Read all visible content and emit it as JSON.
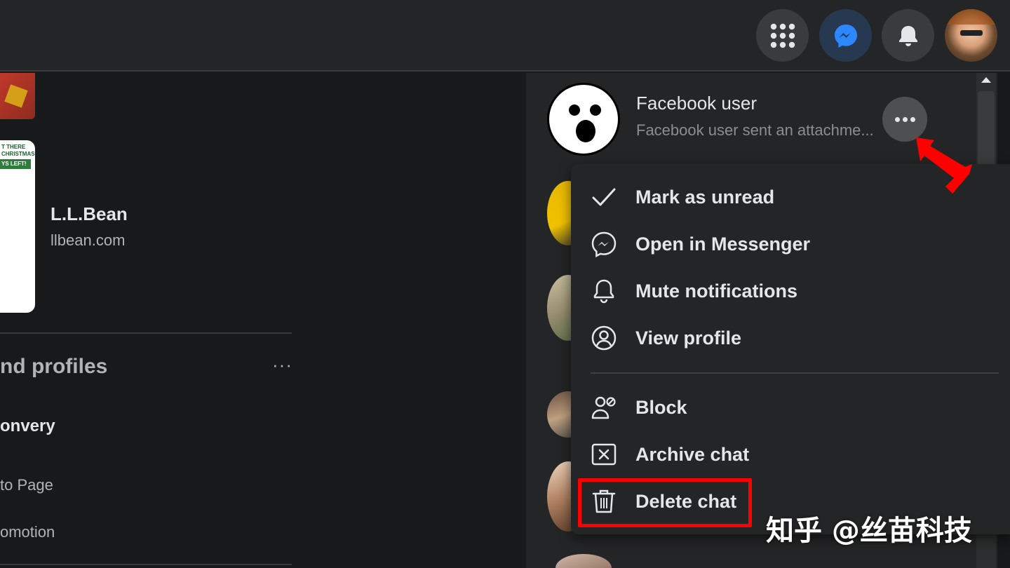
{
  "topbar": {
    "icons": [
      "grid-menu-icon",
      "messenger-icon",
      "notifications-bell-icon",
      "profile-avatar"
    ]
  },
  "left": {
    "ad_card_lines": [
      "T THERE",
      "CHRISTMAS",
      "YS LEFT!"
    ],
    "ad_name": "L.L.Bean",
    "ad_domain": "llbean.com",
    "section_title": "nd profiles",
    "section_more": "···",
    "items": [
      "onvery",
      "to Page",
      "omotion"
    ]
  },
  "conversation": {
    "name": "Facebook user",
    "preview": "Facebook user sent an attachme..."
  },
  "menu": {
    "items": [
      {
        "label": "Mark as unread",
        "icon": "checkmark-icon"
      },
      {
        "label": "Open in Messenger",
        "icon": "messenger-icon"
      },
      {
        "label": "Mute notifications",
        "icon": "bell-icon"
      },
      {
        "label": "View profile",
        "icon": "user-circle-icon"
      },
      {
        "label": "Block",
        "icon": "block-user-icon"
      },
      {
        "label": "Archive chat",
        "icon": "archive-x-icon"
      },
      {
        "label": "Delete chat",
        "icon": "trash-icon"
      }
    ]
  },
  "watermark": "知乎 @丝苗科技",
  "colors": {
    "background": "#18191a",
    "surface": "#242526",
    "highlight": "#ff0000",
    "messenger_blue": "#2d88ff"
  }
}
